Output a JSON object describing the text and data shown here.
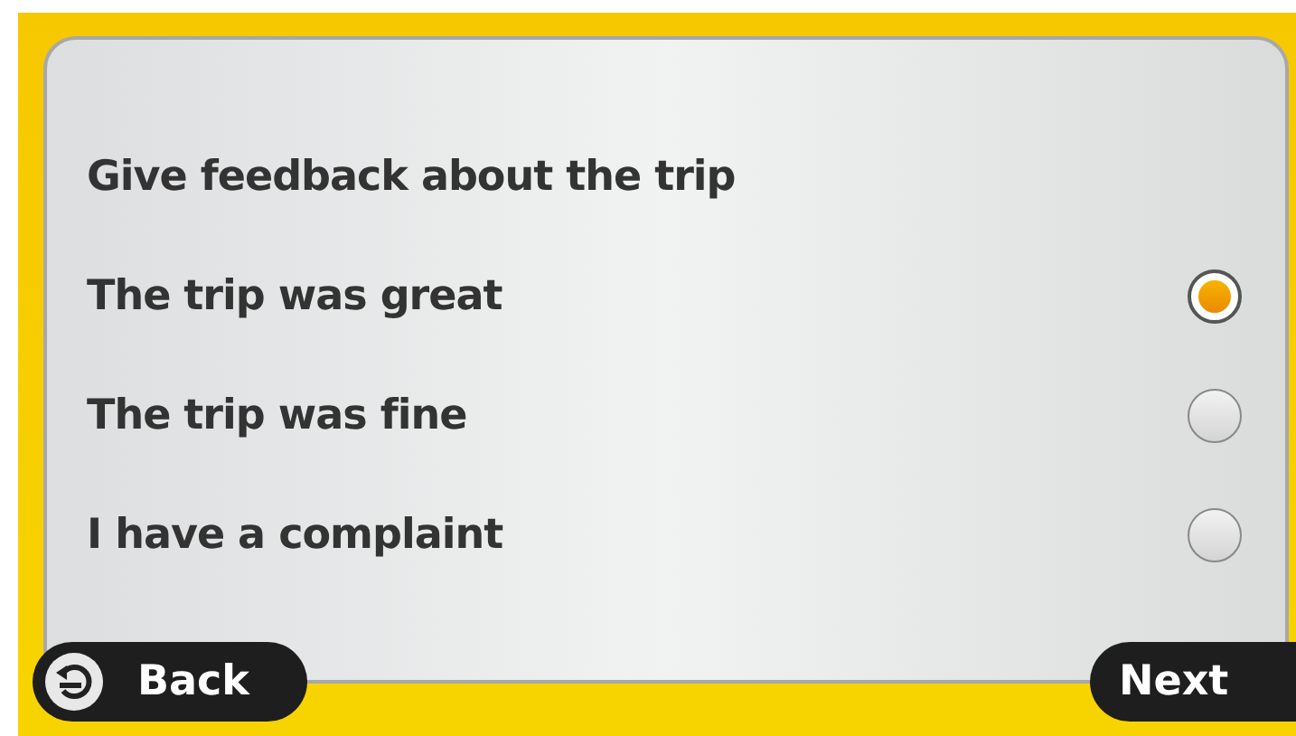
{
  "title": "Give feedback about the trip",
  "options": [
    {
      "label": "The trip was great",
      "selected": true
    },
    {
      "label": "The trip was fine",
      "selected": false
    },
    {
      "label": "I have a complaint",
      "selected": false
    }
  ],
  "buttons": {
    "back": "Back",
    "next": "Next"
  }
}
